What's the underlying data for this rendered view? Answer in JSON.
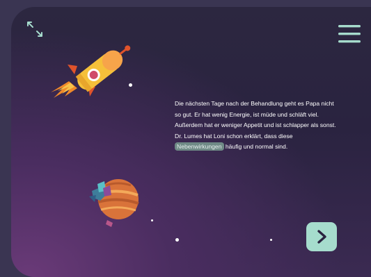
{
  "story": {
    "text_before": "Die nächsten Tage nach der Behandlung geht es Papa nicht so gut. Er hat wenig Energie, ist müde und schläft viel. Außerdem hat er weniger Appetit und ist schlapper als sonst. Dr. Lumes hat Loni schon erklärt, dass diese ",
    "highlight": "Nebenwirkungen",
    "text_after": " häufig und normal sind."
  },
  "colors": {
    "accent": "#a6dccd",
    "highlight_bg": "#6f8a86",
    "rocket_body": "#f5c03a",
    "rocket_fin": "#e0532b"
  },
  "icons": {
    "expand": "expand-arrows-icon",
    "menu": "hamburger-menu-icon",
    "next": "chevron-right-icon"
  }
}
